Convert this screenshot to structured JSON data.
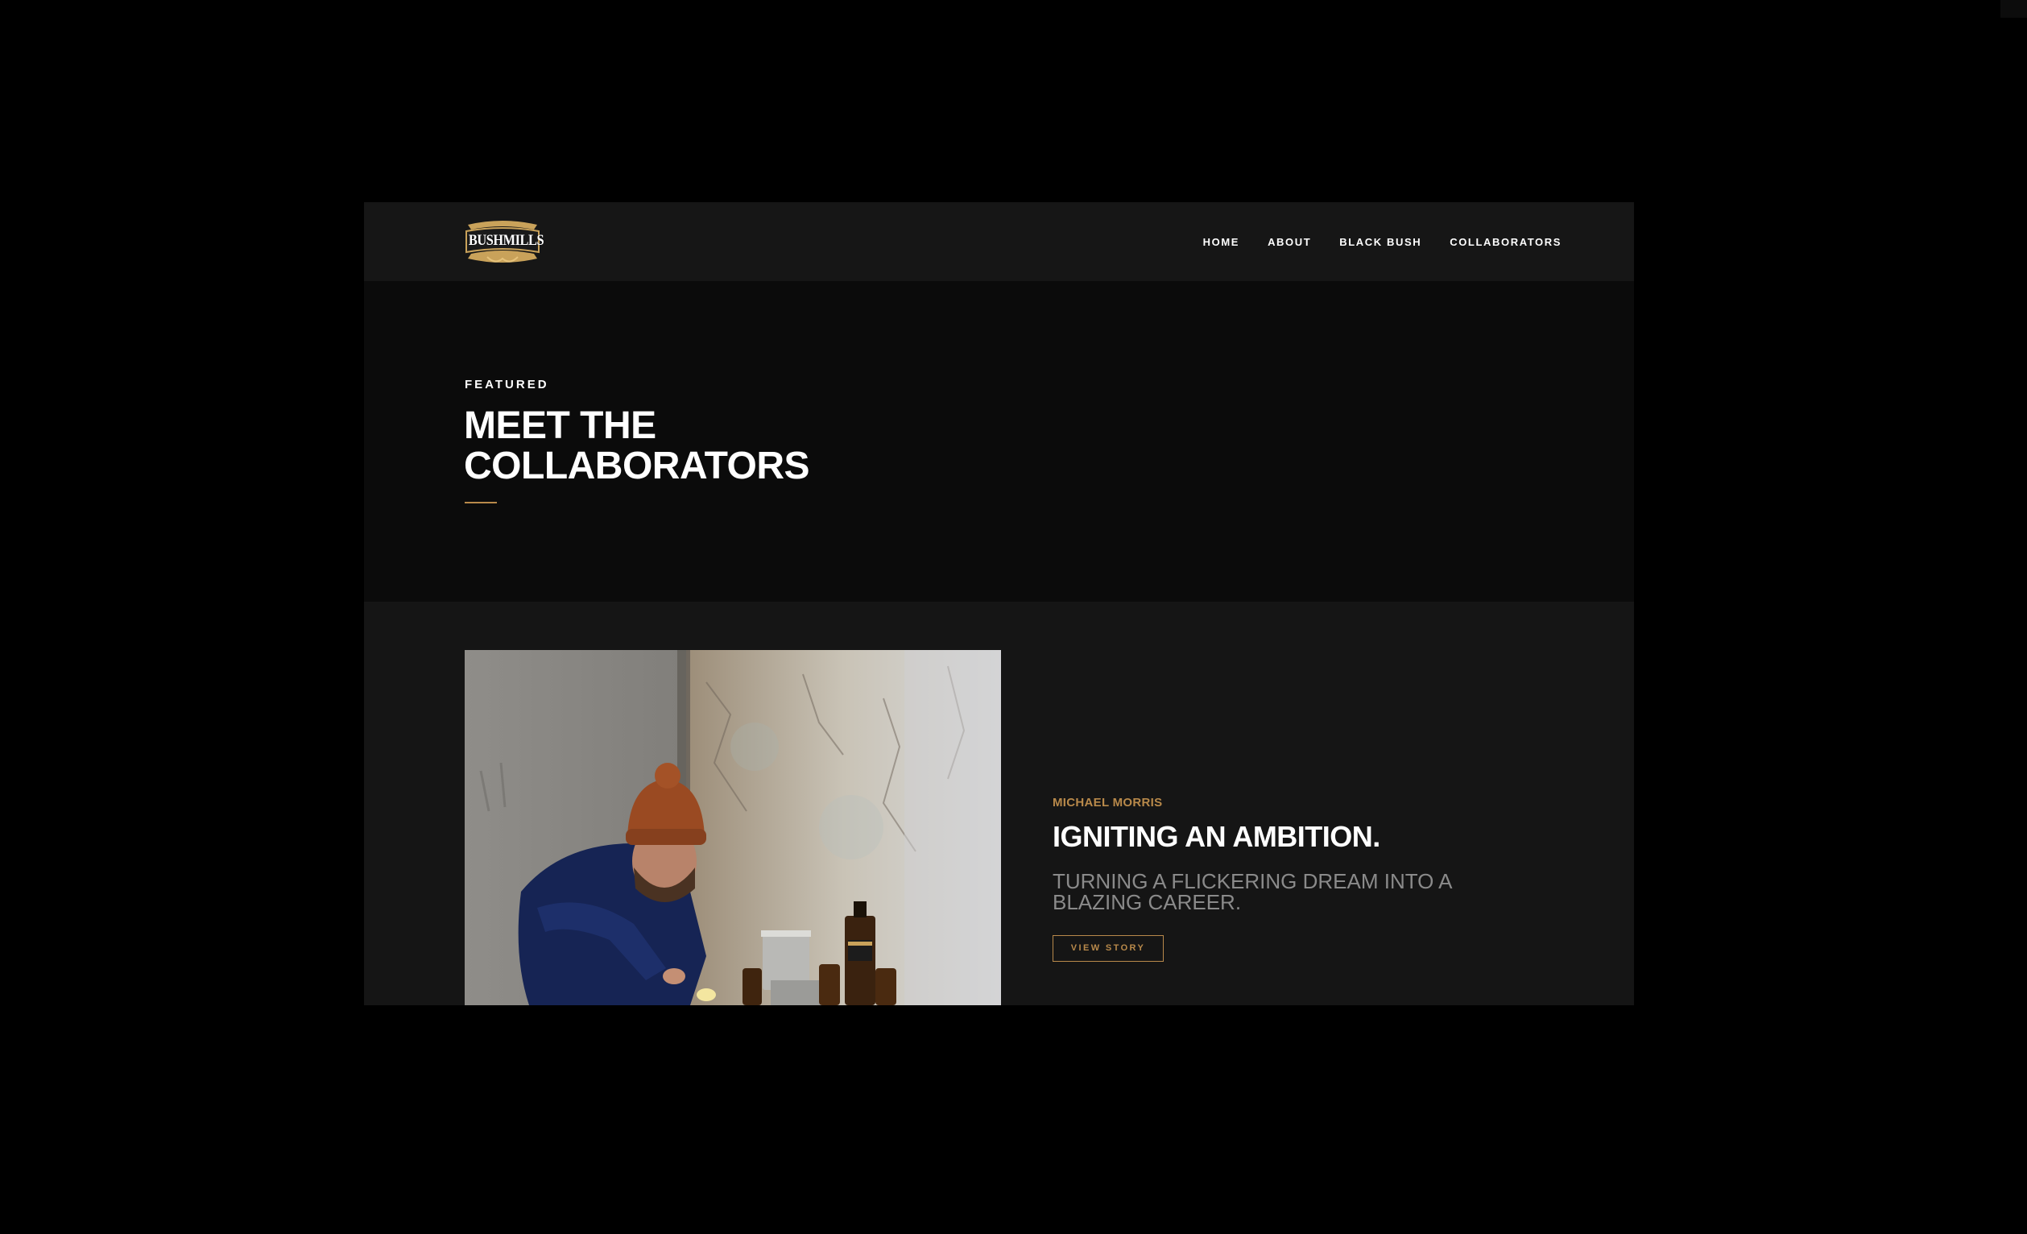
{
  "brand": {
    "logo_text": "BUSHMILLS",
    "accent_color": "#b8894a"
  },
  "nav": {
    "items": [
      {
        "label": "HOME"
      },
      {
        "label": "ABOUT"
      },
      {
        "label": "BLACK BUSH"
      },
      {
        "label": "COLLABORATORS"
      }
    ]
  },
  "hero": {
    "eyebrow": "FEATURED",
    "title_line1": "MEET THE",
    "title_line2": "COLLABORATORS"
  },
  "feature": {
    "photo_icon": "person-pouring-photo",
    "collaborator_name": "MICHAEL MORRIS",
    "title": "IGNITING AN AMBITION.",
    "subtitle": "TURNING A FLICKERING DREAM INTO A BLAZING CAREER.",
    "cta_label": "VIEW STORY"
  }
}
